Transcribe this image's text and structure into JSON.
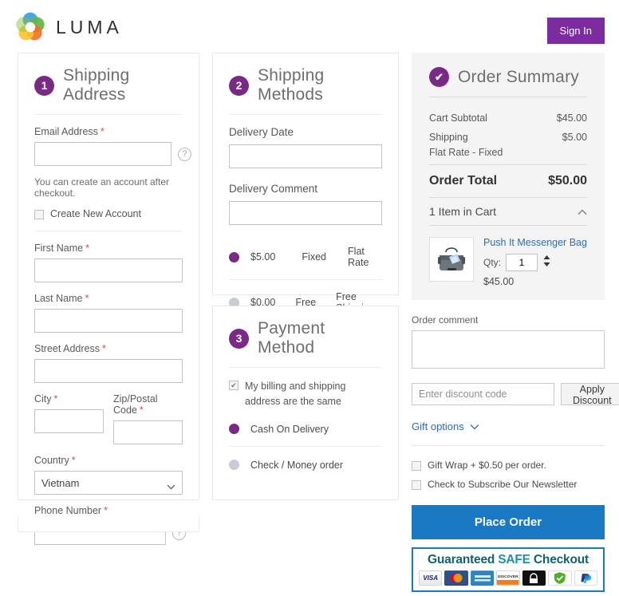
{
  "header": {
    "logo_text": "LUMA",
    "logo_icon": "luma-flower-logo",
    "sign_in_label": "Sign In"
  },
  "shipping_address": {
    "step_number": "1",
    "heading": "Shipping Address",
    "email_label": "Email Address",
    "email_value": "",
    "email_help_icon": "question-mark-icon",
    "email_hint": "You can create an account after checkout.",
    "create_account_label": "Create New Account",
    "create_account_checked": false,
    "first_name_label": "First Name",
    "first_name_value": "",
    "last_name_label": "Last Name",
    "last_name_value": "",
    "street_label": "Street Address",
    "street_value": "",
    "city_label": "City",
    "city_value": "",
    "zip_label": "Zip/Postal Code",
    "zip_value": "",
    "country_label": "Country",
    "country_value": "Vietnam",
    "phone_label": "Phone Number",
    "phone_value": "",
    "phone_help_icon": "question-mark-icon",
    "required_marker": "*"
  },
  "shipping_methods": {
    "step_number": "2",
    "heading": "Shipping Methods",
    "delivery_date_label": "Delivery Date",
    "delivery_date_value": "",
    "delivery_comment_label": "Delivery Comment",
    "delivery_comment_value": "",
    "options": [
      {
        "price": "$5.00",
        "carrier": "Fixed",
        "method": "Flat Rate",
        "selected": true
      },
      {
        "price": "$0.00",
        "carrier": "Free",
        "method": "Free Shipping",
        "selected": false
      }
    ]
  },
  "payment_method": {
    "step_number": "3",
    "heading": "Payment Method",
    "billing_same_label": "My billing and shipping address are the same",
    "billing_same_checked": true,
    "options": [
      {
        "label": "Cash On Delivery",
        "selected": true
      },
      {
        "label": "Check / Money order",
        "selected": false
      }
    ]
  },
  "order_summary": {
    "badge_icon": "check-icon",
    "heading": "Order Summary",
    "lines": [
      {
        "label": "Cart Subtotal",
        "value": "$45.00"
      },
      {
        "label": "Shipping",
        "value": "$5.00"
      }
    ],
    "shipping_sub": "Flat Rate - Fixed",
    "total_label": "Order Total",
    "total_value": "$50.00",
    "items_toggle_label": "1 Item in Cart",
    "items_toggle_icon": "chevron-up-icon",
    "item": {
      "thumb_icon": "messenger-bag-thumbnail",
      "name": "Push It Messenger Bag",
      "qty_label": "Qty:",
      "qty_value": "1",
      "stepper_icon": "up-down-stepper-icon",
      "price": "$45.00"
    }
  },
  "right_rail": {
    "order_comment_label": "Order comment",
    "order_comment_value": "",
    "discount_placeholder": "Enter discount code",
    "discount_value": "",
    "apply_discount_label": "Apply Discount",
    "gift_options_label": "Gift options",
    "gift_options_icon": "chevron-down-icon",
    "gift_wrap_label": "Gift Wrap + $0.50 per order.",
    "gift_wrap_checked": false,
    "newsletter_label": "Check to Subscribe Our Newsletter",
    "newsletter_checked": false,
    "place_order_label": "Place Order"
  },
  "trust_badge": {
    "title_lead": "Guaranteed ",
    "title_safe": "SAFE",
    "title_tail": " Checkout",
    "cards": [
      {
        "name": "visa-card-icon",
        "text": "VISA"
      },
      {
        "name": "mastercard-card-icon",
        "text": ""
      },
      {
        "name": "amex-card-icon",
        "text": "AMEX"
      },
      {
        "name": "discover-card-icon",
        "text": "DISCOVER"
      },
      {
        "name": "trusted-site-icon",
        "text": ""
      },
      {
        "name": "norton-secured-icon",
        "text": ""
      },
      {
        "name": "paypal-icon",
        "text": "PayPal"
      }
    ]
  },
  "colors": {
    "brand_purple": "#7a2a86",
    "signin_purple": "#7d2ba0",
    "action_blue": "#1979c3",
    "link_blue": "#2a6fb5",
    "required_red": "#c8544f",
    "summary_bg": "#f4f4f4"
  }
}
